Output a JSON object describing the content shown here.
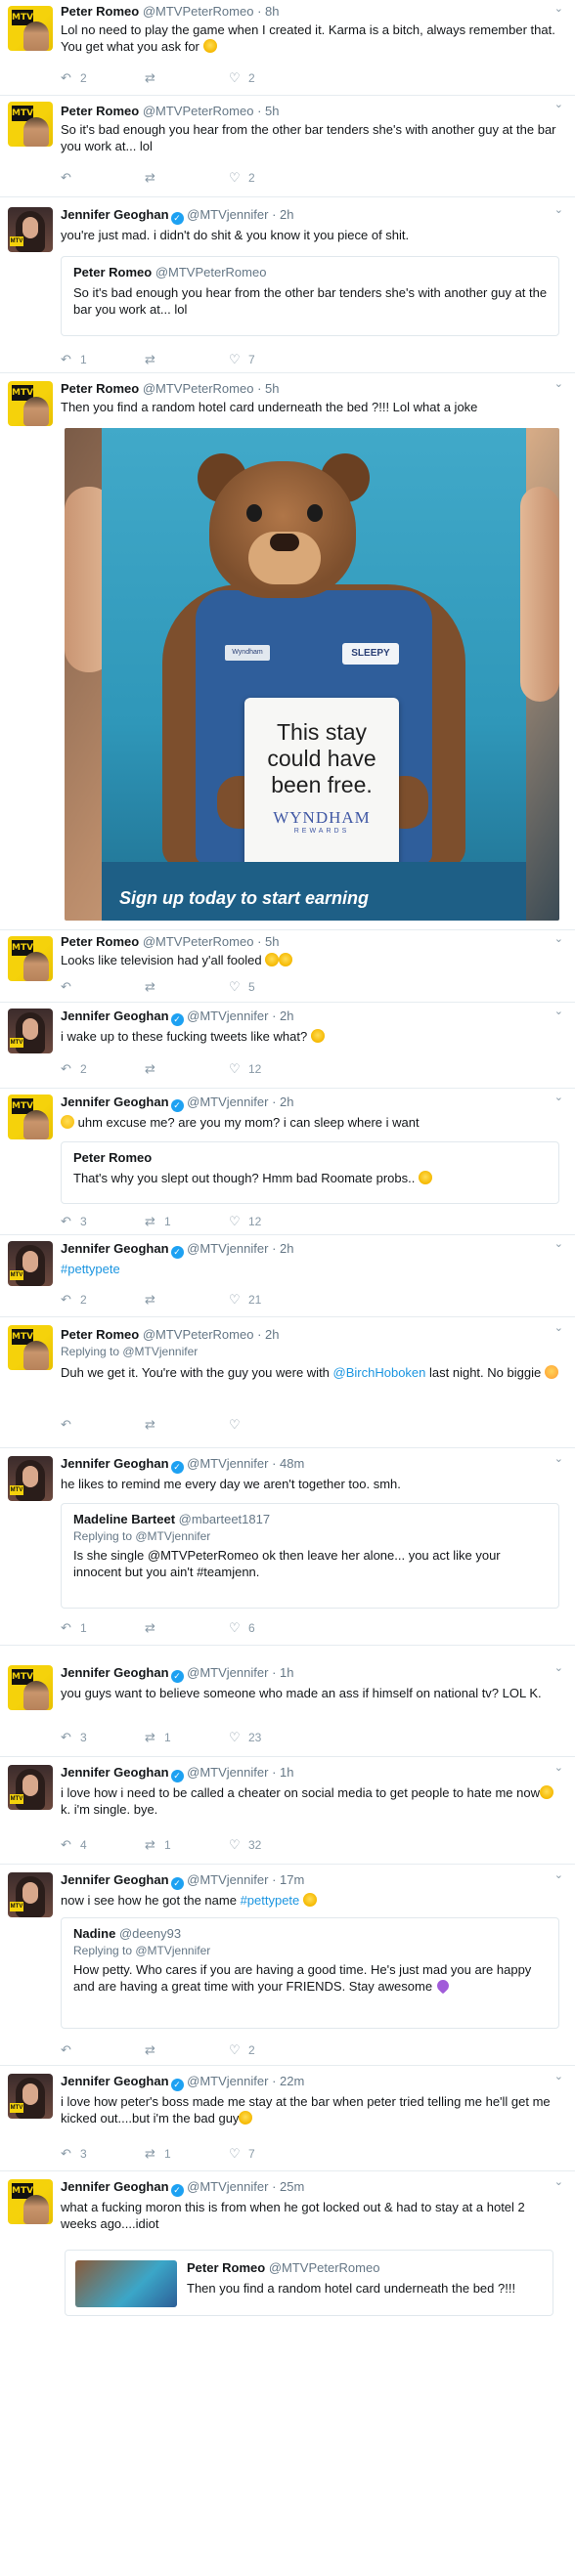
{
  "icons": {
    "reply": "reply-icon",
    "retweet": "retweet-icon",
    "like": "heart-icon",
    "caret": "chevron-down-icon",
    "verified": "verified-badge-icon"
  },
  "colors": {
    "link": "#1b95e0",
    "muted": "#657786",
    "verified": "#1da1f2",
    "mtv_yellow": "#f5d20b"
  },
  "tweets": [
    {
      "name": "Peter Romeo",
      "handle": "@MTVPeterRomeo",
      "time": "8h",
      "text": "Lol no need to play the game when I created it. Karma is a bitch, always remember that. You get what you ask for",
      "reply": "2",
      "retweet": "",
      "like": "2"
    },
    {
      "name": "Peter Romeo",
      "handle": "@MTVPeterRomeo",
      "time": "5h",
      "text": "So it's bad enough you hear from the other bar tenders she's with another guy at the bar you work at... lol",
      "reply": "",
      "retweet": "",
      "like": "2"
    },
    {
      "name": "Jennifer Geoghan",
      "handle": "@MTVjennifer",
      "time": "2h",
      "text": "you're just mad. i didn't do shit & you know it you piece of shit.",
      "quote_name": "Peter Romeo",
      "quote_handle": "@MTVPeterRomeo",
      "quote_text": "So it's bad enough you hear from the other bar tenders she's with another guy at the bar you work at... lol",
      "reply": "1",
      "retweet": "",
      "like": "7"
    },
    {
      "name": "Peter Romeo",
      "handle": "@MTVPeterRomeo",
      "time": "5h",
      "text": "Then you find a random hotel card underneath the bed ?!!! Lol what a joke",
      "photo": {
        "sign_line1": "This stay",
        "sign_line2": "could have",
        "sign_line3": "been free.",
        "brand": "WYNDHAM",
        "brand_sub": "REWARDS",
        "badge": "SLEEPY",
        "tag": "Wyndham",
        "cta": "Sign up today to start earning"
      }
    },
    {
      "name": "Peter Romeo",
      "handle": "@MTVPeterRomeo",
      "time": "5h",
      "text": "Looks like television had y'all fooled",
      "reply": "",
      "retweet": "",
      "like": "5"
    },
    {
      "name": "Jennifer Geoghan",
      "handle": "@MTVjennifer",
      "time": "2h",
      "text": "i wake up to these fucking tweets like what?",
      "reply": "2",
      "retweet": "",
      "like": "12"
    },
    {
      "name": "Jennifer Geoghan",
      "handle": "@MTVjennifer",
      "time": "2h",
      "text": "uhm excuse me? are you my mom? i can sleep where i want",
      "quote_name": "Peter Romeo",
      "quote_handle": "",
      "quote_text": "That's why you slept out though? Hmm bad Roomate probs..",
      "reply": "3",
      "retweet": "1",
      "like": "12"
    },
    {
      "name": "Jennifer Geoghan",
      "handle": "@MTVjennifer",
      "time": "2h",
      "text": "#pettypete",
      "reply": "2",
      "retweet": "",
      "like": "21"
    },
    {
      "name": "Peter Romeo",
      "handle": "@MTVPeterRomeo",
      "time": "2h",
      "replying": "Replying to @MTVjennifer",
      "text_a": "Duh we get it. You're with the guy you were with ",
      "mention": "@BirchHoboken",
      "text_b": " last night. No biggie",
      "reply": "",
      "retweet": "",
      "like": ""
    },
    {
      "name": "Jennifer Geoghan",
      "handle": "@MTVjennifer",
      "time": "48m",
      "text": "he likes to remind me every day we aren't together too. smh.",
      "quote_name": "Madeline Barteet",
      "quote_handle": "@mbarteet1817",
      "quote_replying": "Replying to @MTVjennifer",
      "quote_text": "Is she single @MTVPeterRomeo  ok then leave her alone... you act like your innocent but you ain't #teamjenn.",
      "reply": "1",
      "retweet": "",
      "like": "6"
    },
    {
      "name": "Jennifer Geoghan",
      "handle": "@MTVjennifer",
      "time": "1h",
      "text": "you guys want to believe someone who made an ass if himself on national tv? LOL K.",
      "reply": "3",
      "retweet": "1",
      "like": "23"
    },
    {
      "name": "Jennifer Geoghan",
      "handle": "@MTVjennifer",
      "time": "1h",
      "text_a": "i love how i need to be called a cheater on social media to get people to hate me now",
      "text_b": " k. i'm single. bye.",
      "reply": "4",
      "retweet": "1",
      "like": "32"
    },
    {
      "name": "Jennifer Geoghan",
      "handle": "@MTVjennifer",
      "time": "17m",
      "text_a": "now i see how he got the name ",
      "hashtag": "#pettypete",
      "quote_name": "Nadine",
      "quote_handle": "@deeny93",
      "quote_replying": "Replying to @MTVjennifer",
      "quote_text": "How petty. Who cares if you are having a good time. He's just mad you are happy and are having a great time with your FRIENDS. Stay awesome",
      "reply": "",
      "retweet": "",
      "like": "2"
    },
    {
      "name": "Jennifer Geoghan",
      "handle": "@MTVjennifer",
      "time": "22m",
      "text": "i love how peter's boss made me stay at the bar when peter tried telling me he'll get me kicked out....but i'm the bad guy",
      "reply": "3",
      "retweet": "1",
      "like": "7"
    },
    {
      "name": "Jennifer Geoghan",
      "handle": "@MTVjennifer",
      "time": "25m",
      "text": "what a fucking moron this is from when he got locked out & had to stay at a hotel 2 weeks ago....idiot",
      "quote_name": "Peter Romeo",
      "quote_handle": "@MTVPeterRomeo",
      "quote_text": "Then you find a random hotel card underneath the bed ?!!!"
    }
  ]
}
